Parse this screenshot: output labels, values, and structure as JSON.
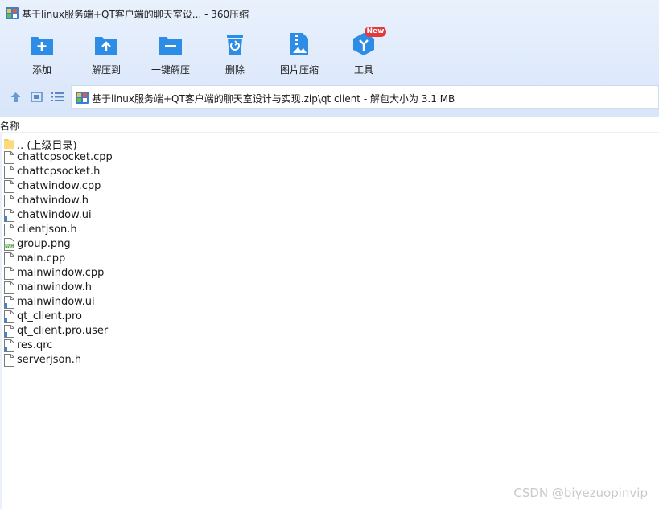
{
  "window": {
    "title": "基于linux服务端+QT客户端的聊天室设... - 360压缩"
  },
  "toolbar": {
    "buttons": [
      {
        "label": "添加",
        "icon": "add-folder-icon"
      },
      {
        "label": "解压到",
        "icon": "extract-to-icon"
      },
      {
        "label": "一键解压",
        "icon": "one-click-extract-icon"
      },
      {
        "label": "删除",
        "icon": "trash-icon"
      },
      {
        "label": "图片压缩",
        "icon": "image-compress-icon"
      },
      {
        "label": "工具",
        "icon": "tools-cube-icon"
      }
    ],
    "new_badge": "New"
  },
  "address": {
    "path": "基于linux服务端+QT客户端的聊天室设计与实现.zip\\qt client - 解包大小为 3.1 MB"
  },
  "list": {
    "column_name": "名称",
    "files": [
      {
        "name": ".. (上级目录)",
        "type": "folder"
      },
      {
        "name": "chattcpsocket.cpp",
        "type": "file"
      },
      {
        "name": "chattcpsocket.h",
        "type": "file"
      },
      {
        "name": "chatwindow.cpp",
        "type": "file"
      },
      {
        "name": "chatwindow.h",
        "type": "file"
      },
      {
        "name": "chatwindow.ui",
        "type": "ui"
      },
      {
        "name": "clientjson.h",
        "type": "file"
      },
      {
        "name": "group.png",
        "type": "png"
      },
      {
        "name": "main.cpp",
        "type": "file"
      },
      {
        "name": "mainwindow.cpp",
        "type": "file"
      },
      {
        "name": "mainwindow.h",
        "type": "file"
      },
      {
        "name": "mainwindow.ui",
        "type": "ui"
      },
      {
        "name": "qt_client.pro",
        "type": "ui"
      },
      {
        "name": "qt_client.pro.user",
        "type": "ui"
      },
      {
        "name": "res.qrc",
        "type": "ui"
      },
      {
        "name": "serverjson.h",
        "type": "file"
      }
    ]
  },
  "watermark": "CSDN @biyezuopinvip",
  "colors": {
    "accent_blue": "#2d8de6",
    "chrome_bg": "#dfeafb",
    "badge_red": "#e23a3a"
  }
}
